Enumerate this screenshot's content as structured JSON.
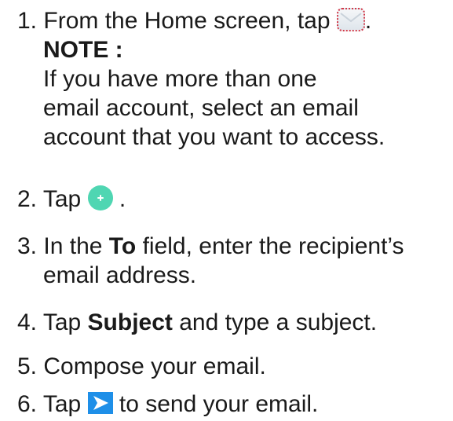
{
  "steps": [
    {
      "number": "1.",
      "before": "From the Home screen, tap",
      "after": ".",
      "icon": "email-app-icon",
      "note_label": "NOTE :",
      "note_lines": [
        "If you have more than one",
        "email account, select an email",
        "account that you want to access."
      ]
    },
    {
      "number": "2.",
      "before": "Tap",
      "after": ".",
      "icon": "compose-plus-icon"
    },
    {
      "number": "3.",
      "line1_before": "In the",
      "line1_bold": "To",
      "line1_after": "field, enter the recipient’s",
      "line2": "email address."
    },
    {
      "number": "4.",
      "before": "Tap",
      "bold": "Subject",
      "after": "and type a subject."
    },
    {
      "number": "5.",
      "text": "Compose your email."
    },
    {
      "number": "6.",
      "before": "Tap",
      "after": "to send your email.",
      "icon": "send-arrow-icon"
    }
  ],
  "colors": {
    "compose_icon": "#4fd6b2",
    "send_icon": "#1e8fe8",
    "email_icon_border": "#d23a4a"
  }
}
